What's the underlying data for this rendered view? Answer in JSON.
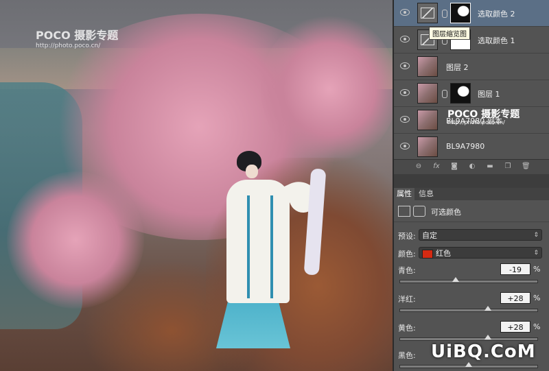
{
  "photo": {
    "watermark": {
      "title": "POCO 摄影专题",
      "url": "http://photo.poco.cn/"
    }
  },
  "layers_panel": {
    "tooltip": "图层缩览图",
    "layers": [
      {
        "name": "选取颜色 2",
        "type": "adjustment",
        "selected": true
      },
      {
        "name": "选取颜色 1",
        "type": "adjustment",
        "selected": false
      },
      {
        "name": "图层 2",
        "type": "image",
        "selected": false
      },
      {
        "name": "图层 1",
        "type": "image-with-mask",
        "selected": false
      },
      {
        "name": "BL9A7980 副本",
        "type": "image",
        "selected": false
      },
      {
        "name": "BL9A7980",
        "type": "image",
        "selected": false
      }
    ],
    "overlay_watermark": {
      "title": "POCO 摄影专题",
      "url": "http://photo.poco.cn/"
    },
    "footer_icons": [
      "link-icon",
      "fx-icon",
      "mask-icon",
      "adjustment-icon",
      "folder-icon",
      "new-layer-icon",
      "trash-icon"
    ],
    "footer_labels": {
      "fx": "fx"
    }
  },
  "properties_panel": {
    "tabs": [
      "属性",
      "信息"
    ],
    "title": "可选颜色",
    "preset_label": "预设:",
    "preset_value": "自定",
    "color_label": "颜色:",
    "color_value": "红色",
    "color_swatch": "#d42a12",
    "sliders": [
      {
        "label": "青色:",
        "value": "-19",
        "unit": "%",
        "level": 0.405
      },
      {
        "label": "洋红:",
        "value": "+28",
        "unit": "%",
        "level": 0.64
      },
      {
        "label": "黄色:",
        "value": "+28",
        "unit": "%",
        "level": 0.64
      },
      {
        "label": "黑色:",
        "value": "",
        "unit": "",
        "level": 0.5
      }
    ]
  },
  "site_watermark": "UiBQ.CoM"
}
